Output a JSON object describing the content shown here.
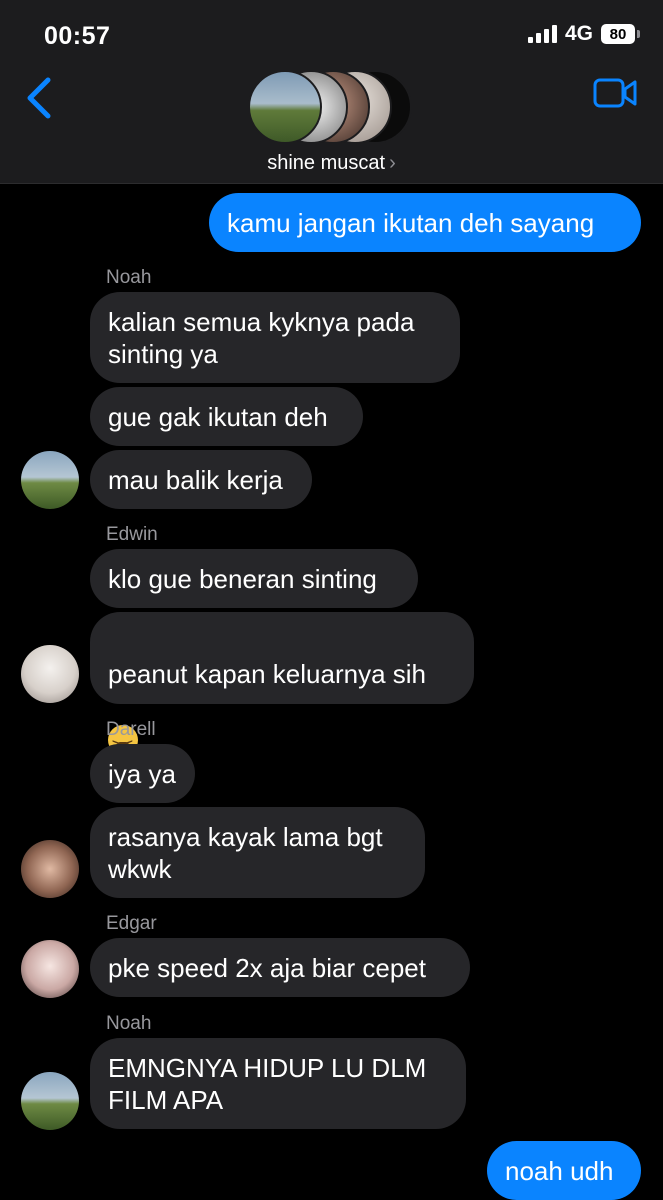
{
  "status_bar": {
    "time": "00:57",
    "network": "4G",
    "battery": "80"
  },
  "header": {
    "group_name": "shine muscat",
    "chevron": "›"
  },
  "messages": {
    "m1": "kamu jangan ikutan deh sayang",
    "noah_label": "Noah",
    "m2": "kalian semua kyknya pada\nsinting ya",
    "m3": "gue gak ikutan deh",
    "m4": "mau balik kerja",
    "edwin_label": "Edwin",
    "m5": "klo gue beneran sinting",
    "m6": "peanut kapan keluarnya sih",
    "darell_label": "Darell",
    "m7": "iya ya",
    "m8": "rasanya kayak lama bgt\nwkwk",
    "edgar_label": "Edgar",
    "m9": "pke speed 2x aja biar cepet",
    "noah_label_2": "Noah",
    "m10": "EMNGNYA HIDUP LU DLM\nFILM APA",
    "m11": "noah udh"
  },
  "colors": {
    "outgoing": "#0a84ff",
    "incoming": "#262629",
    "accent": "#0a84ff"
  },
  "icons": {
    "back": "chevron-left-icon",
    "video": "video-camera-icon",
    "emoji": "tired-face-emoji"
  }
}
